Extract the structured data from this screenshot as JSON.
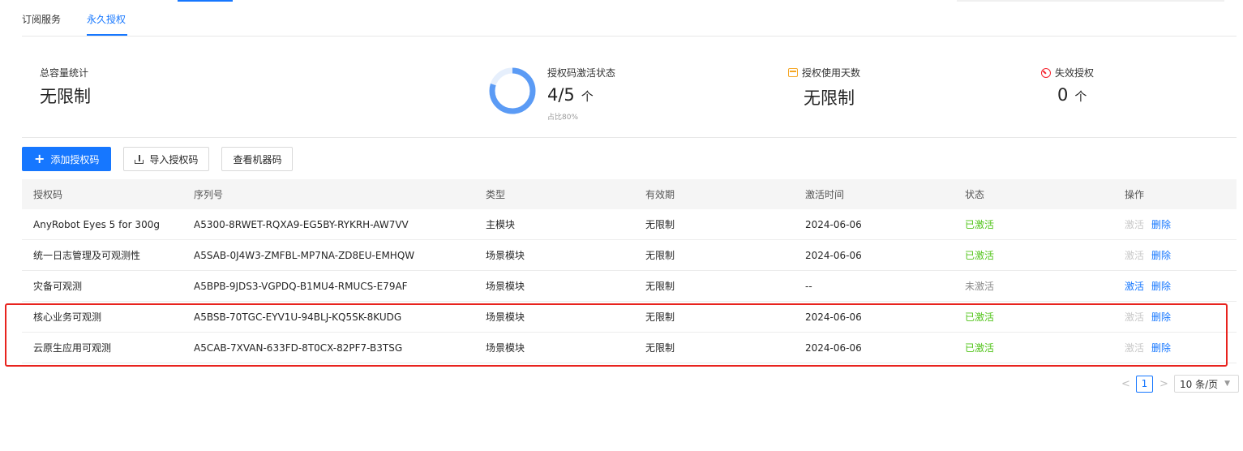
{
  "tabs": [
    {
      "label": "订阅服务",
      "active": false
    },
    {
      "label": "永久授权",
      "active": true
    }
  ],
  "stats": {
    "capacity": {
      "label": "总容量统计",
      "value": "无限制"
    },
    "activation": {
      "label": "授权码激活状态",
      "value": "4/5",
      "unit": "个",
      "ratio_text": "占比80%",
      "ratio": 0.8
    },
    "days": {
      "label": "授权使用天数",
      "value": "无限制",
      "icon": "calendar-icon"
    },
    "invalid": {
      "label": "失效授权",
      "value": "0",
      "unit": "个",
      "icon": "warning-icon"
    }
  },
  "toolbar": {
    "add_label": "添加授权码",
    "import_label": "导入授权码",
    "machine_label": "查看机器码"
  },
  "table": {
    "columns": [
      "授权码",
      "序列号",
      "类型",
      "有效期",
      "激活时间",
      "状态",
      "操作"
    ],
    "rows": [
      {
        "name": "AnyRobot Eyes 5 for 300g",
        "serial": "A5300-8RWET-RQXA9-EG5BY-RYKRH-AW7VV",
        "type": "主模块",
        "validity": "无限制",
        "activated_at": "2024-06-06",
        "status": "已激活",
        "active": true,
        "activate_label": "激活",
        "delete_label": "删除"
      },
      {
        "name": "统一日志管理及可观测性",
        "serial": "A5SAB-0J4W3-ZMFBL-MP7NA-ZD8EU-EMHQW",
        "type": "场景模块",
        "validity": "无限制",
        "activated_at": "2024-06-06",
        "status": "已激活",
        "active": true,
        "activate_label": "激活",
        "delete_label": "删除"
      },
      {
        "name": "灾备可观测",
        "serial": "A5BPB-9JDS3-VGPDQ-B1MU4-RMUCS-E79AF",
        "type": "场景模块",
        "validity": "无限制",
        "activated_at": "--",
        "status": "未激活",
        "active": false,
        "activate_label": "激活",
        "delete_label": "删除"
      },
      {
        "name": "核心业务可观测",
        "serial": "A5BSB-70TGC-EYV1U-94BLJ-KQ5SK-8KUDG",
        "type": "场景模块",
        "validity": "无限制",
        "activated_at": "2024-06-06",
        "status": "已激活",
        "active": true,
        "activate_label": "激活",
        "delete_label": "删除"
      },
      {
        "name": "云原生应用可观测",
        "serial": "A5CAB-7XVAN-633FD-8T0CX-82PF7-B3TSG",
        "type": "场景模块",
        "validity": "无限制",
        "activated_at": "2024-06-06",
        "status": "已激活",
        "active": true,
        "activate_label": "激活",
        "delete_label": "删除"
      }
    ]
  },
  "pagination": {
    "prev": "<",
    "current": "1",
    "next": ">",
    "page_size": "10 条/页"
  },
  "colors": {
    "primary": "#1677ff",
    "success": "#52c41a",
    "highlight": "#e8231e",
    "donut": "#5b9bf5"
  }
}
